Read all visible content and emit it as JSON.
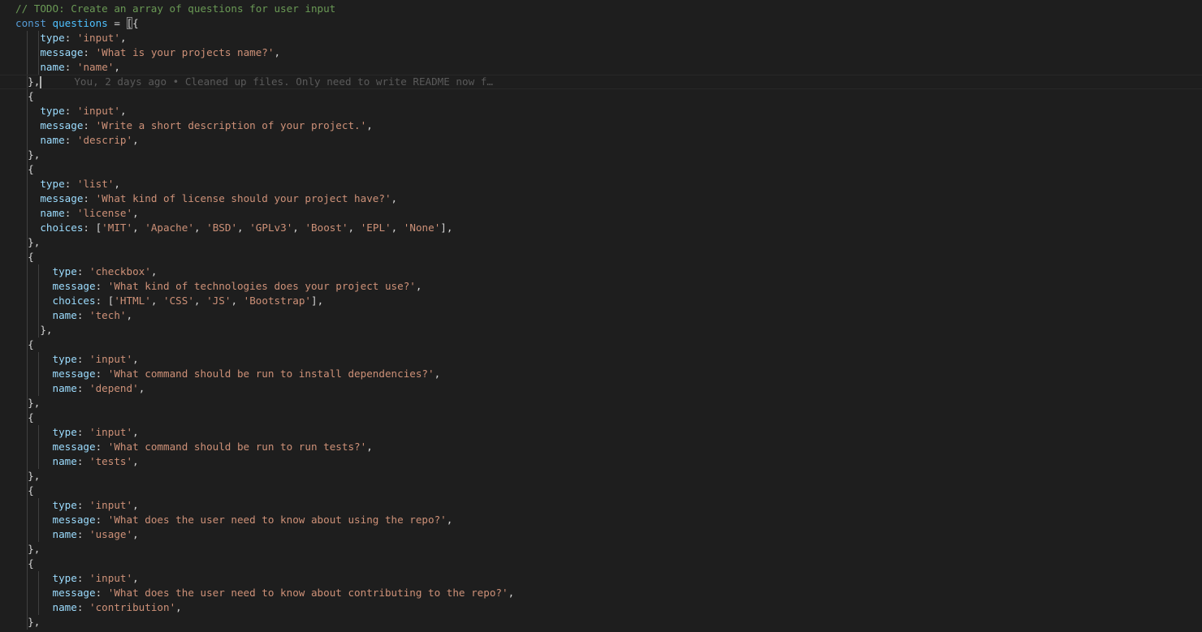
{
  "editor": {
    "language": "javascript",
    "colors": {
      "background": "#1e1e1e",
      "comment": "#6a9955",
      "keyword": "#569cd6",
      "variable": "#4fc1ff",
      "property": "#9cdcfe",
      "string": "#ce9178",
      "punctuation": "#d4d4d4"
    },
    "blame": "You, 2 days ago • Cleaned up files. Only need to write README now f…",
    "lines": [
      {
        "indent": 0,
        "guides": 0,
        "tokens": [
          {
            "t": "// TODO: Create an array of questions for user input",
            "c": "comment"
          }
        ]
      },
      {
        "indent": 0,
        "guides": 0,
        "tokens": [
          {
            "t": "const",
            "c": "keyword"
          },
          {
            "t": " ",
            "c": "punct"
          },
          {
            "t": "questions",
            "c": "var"
          },
          {
            "t": " = ",
            "c": "punct"
          },
          {
            "t": "[",
            "c": "bracket-hl"
          },
          {
            "t": "{",
            "c": "punct"
          }
        ]
      },
      {
        "indent": 4,
        "guides": 2,
        "tokens": [
          {
            "t": "type",
            "c": "prop"
          },
          {
            "t": ": ",
            "c": "punct"
          },
          {
            "t": "'input'",
            "c": "string"
          },
          {
            "t": ",",
            "c": "punct"
          }
        ]
      },
      {
        "indent": 4,
        "guides": 2,
        "tokens": [
          {
            "t": "message",
            "c": "prop"
          },
          {
            "t": ": ",
            "c": "punct"
          },
          {
            "t": "'What is your projects name?'",
            "c": "string"
          },
          {
            "t": ",",
            "c": "punct"
          }
        ]
      },
      {
        "indent": 4,
        "guides": 2,
        "tokens": [
          {
            "t": "name",
            "c": "prop"
          },
          {
            "t": ": ",
            "c": "punct"
          },
          {
            "t": "'name'",
            "c": "string"
          },
          {
            "t": ",",
            "c": "punct"
          }
        ]
      },
      {
        "indent": 2,
        "guides": 1,
        "current": true,
        "tokens": [
          {
            "t": "},",
            "c": "punct"
          }
        ],
        "cursor": true,
        "blame": true
      },
      {
        "indent": 2,
        "guides": 1,
        "tokens": [
          {
            "t": "{",
            "c": "punct"
          }
        ]
      },
      {
        "indent": 4,
        "guides": 1,
        "tokens": [
          {
            "t": "type",
            "c": "prop"
          },
          {
            "t": ": ",
            "c": "punct"
          },
          {
            "t": "'input'",
            "c": "string"
          },
          {
            "t": ",",
            "c": "punct"
          }
        ]
      },
      {
        "indent": 4,
        "guides": 1,
        "tokens": [
          {
            "t": "message",
            "c": "prop"
          },
          {
            "t": ": ",
            "c": "punct"
          },
          {
            "t": "'Write a short description of your project.'",
            "c": "string"
          },
          {
            "t": ",",
            "c": "punct"
          }
        ]
      },
      {
        "indent": 4,
        "guides": 1,
        "tokens": [
          {
            "t": "name",
            "c": "prop"
          },
          {
            "t": ": ",
            "c": "punct"
          },
          {
            "t": "'descrip'",
            "c": "string"
          },
          {
            "t": ",",
            "c": "punct"
          }
        ]
      },
      {
        "indent": 2,
        "guides": 1,
        "tokens": [
          {
            "t": "},",
            "c": "punct"
          }
        ]
      },
      {
        "indent": 2,
        "guides": 1,
        "tokens": [
          {
            "t": "{",
            "c": "punct"
          }
        ]
      },
      {
        "indent": 4,
        "guides": 1,
        "tokens": [
          {
            "t": "type",
            "c": "prop"
          },
          {
            "t": ": ",
            "c": "punct"
          },
          {
            "t": "'list'",
            "c": "string"
          },
          {
            "t": ",",
            "c": "punct"
          }
        ]
      },
      {
        "indent": 4,
        "guides": 1,
        "tokens": [
          {
            "t": "message",
            "c": "prop"
          },
          {
            "t": ": ",
            "c": "punct"
          },
          {
            "t": "'What kind of license should your project have?'",
            "c": "string"
          },
          {
            "t": ",",
            "c": "punct"
          }
        ]
      },
      {
        "indent": 4,
        "guides": 1,
        "tokens": [
          {
            "t": "name",
            "c": "prop"
          },
          {
            "t": ": ",
            "c": "punct"
          },
          {
            "t": "'license'",
            "c": "string"
          },
          {
            "t": ",",
            "c": "punct"
          }
        ]
      },
      {
        "indent": 4,
        "guides": 1,
        "tokens": [
          {
            "t": "choices",
            "c": "prop"
          },
          {
            "t": ": [",
            "c": "punct"
          },
          {
            "t": "'MIT'",
            "c": "string"
          },
          {
            "t": ", ",
            "c": "punct"
          },
          {
            "t": "'Apache'",
            "c": "string"
          },
          {
            "t": ", ",
            "c": "punct"
          },
          {
            "t": "'BSD'",
            "c": "string"
          },
          {
            "t": ", ",
            "c": "punct"
          },
          {
            "t": "'GPLv3'",
            "c": "string"
          },
          {
            "t": ", ",
            "c": "punct"
          },
          {
            "t": "'Boost'",
            "c": "string"
          },
          {
            "t": ", ",
            "c": "punct"
          },
          {
            "t": "'EPL'",
            "c": "string"
          },
          {
            "t": ", ",
            "c": "punct"
          },
          {
            "t": "'None'",
            "c": "string"
          },
          {
            "t": "],",
            "c": "punct"
          }
        ]
      },
      {
        "indent": 2,
        "guides": 1,
        "tokens": [
          {
            "t": "},",
            "c": "punct"
          }
        ]
      },
      {
        "indent": 2,
        "guides": 1,
        "tokens": [
          {
            "t": "{",
            "c": "punct"
          }
        ]
      },
      {
        "indent": 6,
        "guides": 2,
        "tokens": [
          {
            "t": "type",
            "c": "prop"
          },
          {
            "t": ": ",
            "c": "punct"
          },
          {
            "t": "'checkbox'",
            "c": "string"
          },
          {
            "t": ",",
            "c": "punct"
          }
        ]
      },
      {
        "indent": 6,
        "guides": 2,
        "tokens": [
          {
            "t": "message",
            "c": "prop"
          },
          {
            "t": ": ",
            "c": "punct"
          },
          {
            "t": "'What kind of technologies does your project use?'",
            "c": "string"
          },
          {
            "t": ",",
            "c": "punct"
          }
        ]
      },
      {
        "indent": 6,
        "guides": 2,
        "tokens": [
          {
            "t": "choices",
            "c": "prop"
          },
          {
            "t": ": [",
            "c": "punct"
          },
          {
            "t": "'HTML'",
            "c": "string"
          },
          {
            "t": ", ",
            "c": "punct"
          },
          {
            "t": "'CSS'",
            "c": "string"
          },
          {
            "t": ", ",
            "c": "punct"
          },
          {
            "t": "'JS'",
            "c": "string"
          },
          {
            "t": ", ",
            "c": "punct"
          },
          {
            "t": "'Bootstrap'",
            "c": "string"
          },
          {
            "t": "],",
            "c": "punct"
          }
        ]
      },
      {
        "indent": 6,
        "guides": 2,
        "tokens": [
          {
            "t": "name",
            "c": "prop"
          },
          {
            "t": ": ",
            "c": "punct"
          },
          {
            "t": "'tech'",
            "c": "string"
          },
          {
            "t": ",",
            "c": "punct"
          }
        ]
      },
      {
        "indent": 4,
        "guides": 2,
        "tokens": [
          {
            "t": "},",
            "c": "punct"
          }
        ]
      },
      {
        "indent": 2,
        "guides": 1,
        "tokens": [
          {
            "t": "{",
            "c": "punct"
          }
        ]
      },
      {
        "indent": 6,
        "guides": 2,
        "tokens": [
          {
            "t": "type",
            "c": "prop"
          },
          {
            "t": ": ",
            "c": "punct"
          },
          {
            "t": "'input'",
            "c": "string"
          },
          {
            "t": ",",
            "c": "punct"
          }
        ]
      },
      {
        "indent": 6,
        "guides": 2,
        "tokens": [
          {
            "t": "message",
            "c": "prop"
          },
          {
            "t": ": ",
            "c": "punct"
          },
          {
            "t": "'What command should be run to install dependencies?'",
            "c": "string"
          },
          {
            "t": ",",
            "c": "punct"
          }
        ]
      },
      {
        "indent": 6,
        "guides": 2,
        "tokens": [
          {
            "t": "name",
            "c": "prop"
          },
          {
            "t": ": ",
            "c": "punct"
          },
          {
            "t": "'depend'",
            "c": "string"
          },
          {
            "t": ",",
            "c": "punct"
          }
        ]
      },
      {
        "indent": 2,
        "guides": 1,
        "tokens": [
          {
            "t": "},",
            "c": "punct"
          }
        ]
      },
      {
        "indent": 2,
        "guides": 1,
        "tokens": [
          {
            "t": "{",
            "c": "punct"
          }
        ]
      },
      {
        "indent": 6,
        "guides": 2,
        "tokens": [
          {
            "t": "type",
            "c": "prop"
          },
          {
            "t": ": ",
            "c": "punct"
          },
          {
            "t": "'input'",
            "c": "string"
          },
          {
            "t": ",",
            "c": "punct"
          }
        ]
      },
      {
        "indent": 6,
        "guides": 2,
        "tokens": [
          {
            "t": "message",
            "c": "prop"
          },
          {
            "t": ": ",
            "c": "punct"
          },
          {
            "t": "'What command should be run to run tests?'",
            "c": "string"
          },
          {
            "t": ",",
            "c": "punct"
          }
        ]
      },
      {
        "indent": 6,
        "guides": 2,
        "tokens": [
          {
            "t": "name",
            "c": "prop"
          },
          {
            "t": ": ",
            "c": "punct"
          },
          {
            "t": "'tests'",
            "c": "string"
          },
          {
            "t": ",",
            "c": "punct"
          }
        ]
      },
      {
        "indent": 2,
        "guides": 1,
        "tokens": [
          {
            "t": "},",
            "c": "punct"
          }
        ]
      },
      {
        "indent": 2,
        "guides": 1,
        "tokens": [
          {
            "t": "{",
            "c": "punct"
          }
        ]
      },
      {
        "indent": 6,
        "guides": 2,
        "tokens": [
          {
            "t": "type",
            "c": "prop"
          },
          {
            "t": ": ",
            "c": "punct"
          },
          {
            "t": "'input'",
            "c": "string"
          },
          {
            "t": ",",
            "c": "punct"
          }
        ]
      },
      {
        "indent": 6,
        "guides": 2,
        "tokens": [
          {
            "t": "message",
            "c": "prop"
          },
          {
            "t": ": ",
            "c": "punct"
          },
          {
            "t": "'What does the user need to know about using the repo?'",
            "c": "string"
          },
          {
            "t": ",",
            "c": "punct"
          }
        ]
      },
      {
        "indent": 6,
        "guides": 2,
        "tokens": [
          {
            "t": "name",
            "c": "prop"
          },
          {
            "t": ": ",
            "c": "punct"
          },
          {
            "t": "'usage'",
            "c": "string"
          },
          {
            "t": ",",
            "c": "punct"
          }
        ]
      },
      {
        "indent": 2,
        "guides": 1,
        "tokens": [
          {
            "t": "},",
            "c": "punct"
          }
        ]
      },
      {
        "indent": 2,
        "guides": 1,
        "tokens": [
          {
            "t": "{",
            "c": "punct"
          }
        ]
      },
      {
        "indent": 6,
        "guides": 2,
        "tokens": [
          {
            "t": "type",
            "c": "prop"
          },
          {
            "t": ": ",
            "c": "punct"
          },
          {
            "t": "'input'",
            "c": "string"
          },
          {
            "t": ",",
            "c": "punct"
          }
        ]
      },
      {
        "indent": 6,
        "guides": 2,
        "tokens": [
          {
            "t": "message",
            "c": "prop"
          },
          {
            "t": ": ",
            "c": "punct"
          },
          {
            "t": "'What does the user need to know about contributing to the repo?'",
            "c": "string"
          },
          {
            "t": ",",
            "c": "punct"
          }
        ]
      },
      {
        "indent": 6,
        "guides": 2,
        "tokens": [
          {
            "t": "name",
            "c": "prop"
          },
          {
            "t": ": ",
            "c": "punct"
          },
          {
            "t": "'contribution'",
            "c": "string"
          },
          {
            "t": ",",
            "c": "punct"
          }
        ]
      },
      {
        "indent": 2,
        "guides": 1,
        "tokens": [
          {
            "t": "},",
            "c": "punct"
          }
        ]
      }
    ]
  }
}
